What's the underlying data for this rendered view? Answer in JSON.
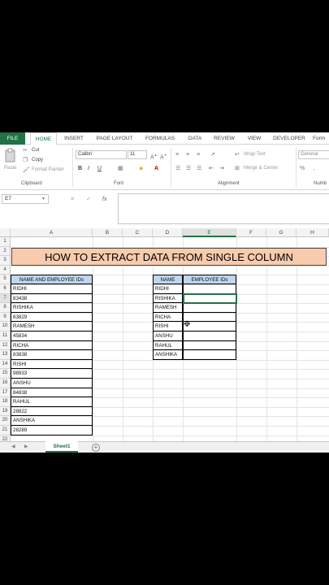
{
  "ribbon_tabs": [
    "FILE",
    "HOME",
    "INSERT",
    "PAGE LAYOUT",
    "FORMULAS",
    "DATA",
    "REVIEW",
    "VIEW",
    "DEVELOPER",
    "Form"
  ],
  "clipboard": {
    "paste": "Paste",
    "cut": "Cut",
    "copy": "Copy",
    "format_painter": "Format Painter",
    "label": "Clipboard"
  },
  "font": {
    "name": "Calibri",
    "size": "11",
    "label": "Font",
    "bold": "B",
    "italic": "I",
    "underline": "U"
  },
  "alignment": {
    "wrap_text": "Wrap Text",
    "merge_center": "Merge & Center",
    "label": "Alignment"
  },
  "number": {
    "format": "General",
    "label": "Numb"
  },
  "formula_bar": {
    "name_box": "E7",
    "cancel": "✕",
    "enter": "✓",
    "fx": "fx",
    "value": ""
  },
  "columns": [
    "A",
    "B",
    "C",
    "D",
    "E",
    "F",
    "G",
    "H"
  ],
  "rows": [
    "1",
    "2",
    "3",
    "4",
    "5",
    "6",
    "7",
    "8",
    "9",
    "10",
    "11",
    "12",
    "13",
    "14",
    "15",
    "16",
    "17",
    "18",
    "19",
    "20",
    "21",
    "22"
  ],
  "title": "HOW TO EXTRACT DATA FROM SINGLE COLUMN",
  "source_table": {
    "header": "NAME AND EMPLOYEE IDs",
    "values": [
      "RIDHI",
      "83438",
      "RISHIKA",
      "83829",
      "RAMESH",
      "45834",
      "RICHA",
      "83838",
      "RISHI",
      "98933",
      "ANSHU",
      "84838",
      "RAHUL",
      "28822",
      "ANSHIKA",
      "28289"
    ]
  },
  "result_table": {
    "headers": [
      "NAME",
      "EMPLOYEE IDs"
    ],
    "names": [
      "RIDHI",
      "RISHIKA",
      "RAMESH",
      "RICHA",
      "RISHI",
      "ANSHU",
      "RAHUL",
      "ANSHIKA"
    ],
    "ids": [
      "",
      "",
      "",
      "",
      "",
      "",
      "",
      ""
    ]
  },
  "sheet_tab": "Sheet1",
  "add_sheet": "+",
  "colors": {
    "excel_green": "#217346",
    "title_fill": "#f8cbad",
    "header_fill": "#bdd7ee"
  }
}
